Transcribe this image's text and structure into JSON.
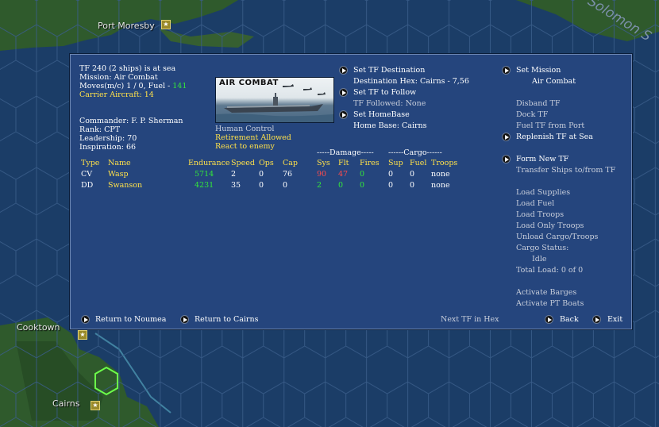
{
  "map": {
    "labels": {
      "port_moresby": "Port Moresby",
      "cooktown": "Cooktown",
      "cairns": "Cairns",
      "solomon": "Solomon S"
    }
  },
  "tf": {
    "header": "TF 240 (2 ships) is at sea",
    "mission": "Mission:  Air Combat",
    "moves_label": "Moves(m/c)  1 / 0, Fuel - ",
    "fuel": "141",
    "carrier_aircraft": "Carrier Aircraft: 14",
    "commander": "Commander: F. P. Sherman",
    "rank": "Rank: CPT",
    "leadership": "Leadership: 70",
    "inspiration": "Inspiration: 66"
  },
  "picture": {
    "title": "AIR COMBAT"
  },
  "status": {
    "control": "Human Control",
    "retirement": "Retirement Allowed",
    "react": "React to enemy"
  },
  "center_actions": {
    "set_destination": "Set TF Destination",
    "destination": "Destination Hex: Cairns - 7,56",
    "set_follow": "Set TF to Follow",
    "followed": "TF Followed: None",
    "set_homebase": "Set HomeBase",
    "homebase": "Home Base: Cairns"
  },
  "right_actions": {
    "set_mission": "Set Mission",
    "mission_value": "Air Combat",
    "disband": "Disband TF",
    "dock": "Dock TF",
    "fuel_from_port": "Fuel TF from Port",
    "replenish": "Replenish TF at Sea",
    "form_new": "Form New TF",
    "transfer": "Transfer Ships to/from TF",
    "load_supplies": "Load Supplies",
    "load_fuel": "Load Fuel",
    "load_troops": "Load Troops",
    "load_only_troops": "Load Only Troops",
    "unload_cargo": "Unload Cargo/Troops",
    "cargo_status": "Cargo Status:",
    "cargo_idle": "Idle",
    "total_load": "Total Load: 0 of 0",
    "activate_barges": "Activate Barges",
    "activate_pt": "Activate PT Boats"
  },
  "table": {
    "group_damage": "-----Damage-----",
    "group_cargo": "------Cargo------",
    "headers": {
      "type": "Type",
      "name": "Name",
      "endurance": "Endurance",
      "speed": "Speed",
      "ops": "Ops",
      "cap": "Cap",
      "sys": "Sys",
      "flt": "Flt",
      "fires": "Fires",
      "sup": "Sup",
      "fuel": "Fuel",
      "troops": "Troops"
    },
    "rows": [
      {
        "type": "CV",
        "name": "Wasp",
        "endurance": "5714",
        "speed": "2",
        "ops": "0",
        "cap": "76",
        "sys": "90",
        "flt": "47",
        "fires": "0",
        "sup": "0",
        "fuel": "0",
        "troops": "none"
      },
      {
        "type": "DD",
        "name": "Swanson",
        "endurance": "4231",
        "speed": "35",
        "ops": "0",
        "cap": "0",
        "sys": "2",
        "flt": "0",
        "fires": "0",
        "sup": "0",
        "fuel": "0",
        "troops": "none"
      }
    ]
  },
  "bottom": {
    "return_noumea": "Return to Noumea",
    "return_cairns": "Return to Cairns",
    "next_tf": "Next TF in Hex",
    "back": "Back",
    "exit": "Exit"
  },
  "colors": {
    "panel": "#25457d",
    "highlight_yellow": "#ffe14a",
    "good_green": "#34e83a",
    "damage_red": "#ff4b4b",
    "sea": "#1c3e68",
    "land": "#2f5a2c"
  }
}
